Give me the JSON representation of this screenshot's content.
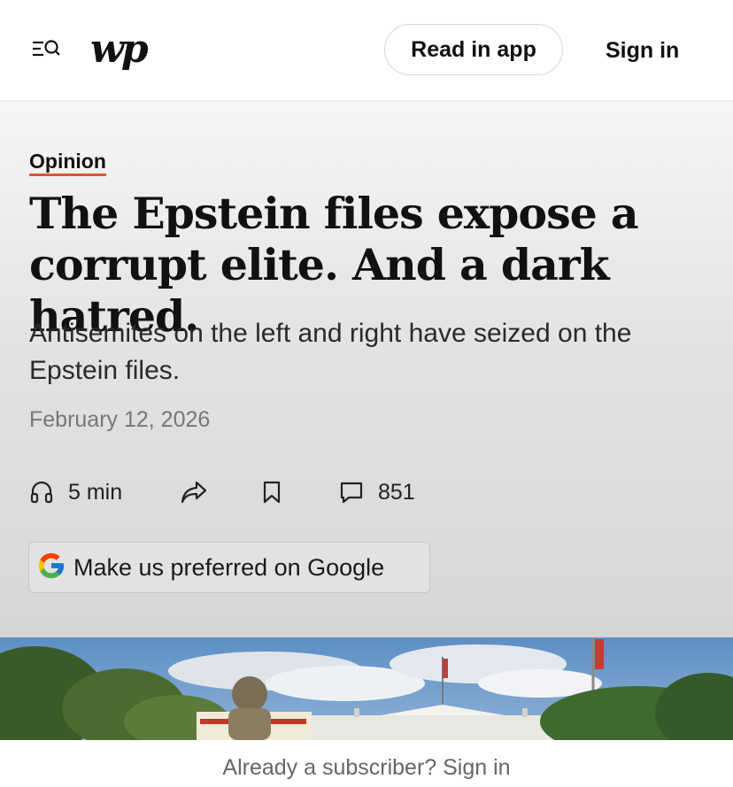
{
  "header": {
    "logo_text": "wp",
    "read_in_app": "Read in app",
    "sign_in": "Sign in"
  },
  "article": {
    "kicker": "Opinion",
    "headline": "The Epstein files expose a corrupt elite. And a dark hatred.",
    "dek": "Antisemites on the left and right have seized on the Epstein files.",
    "date": "February 12, 2026",
    "listen_time": "5 min",
    "comment_count": "851"
  },
  "google_button": {
    "label": "Make us preferred on Google"
  },
  "footer": {
    "prompt": "Already a subscriber? Sign in"
  },
  "icons": {
    "menu": "menu-search-icon",
    "listen": "headphones-icon",
    "share": "share-arrow-icon",
    "save": "bookmark-icon",
    "comments": "comment-bubble-icon",
    "google": "google-g-icon"
  },
  "colors": {
    "kicker_underline": "#e0552d",
    "sky": "#6f9ccb"
  }
}
